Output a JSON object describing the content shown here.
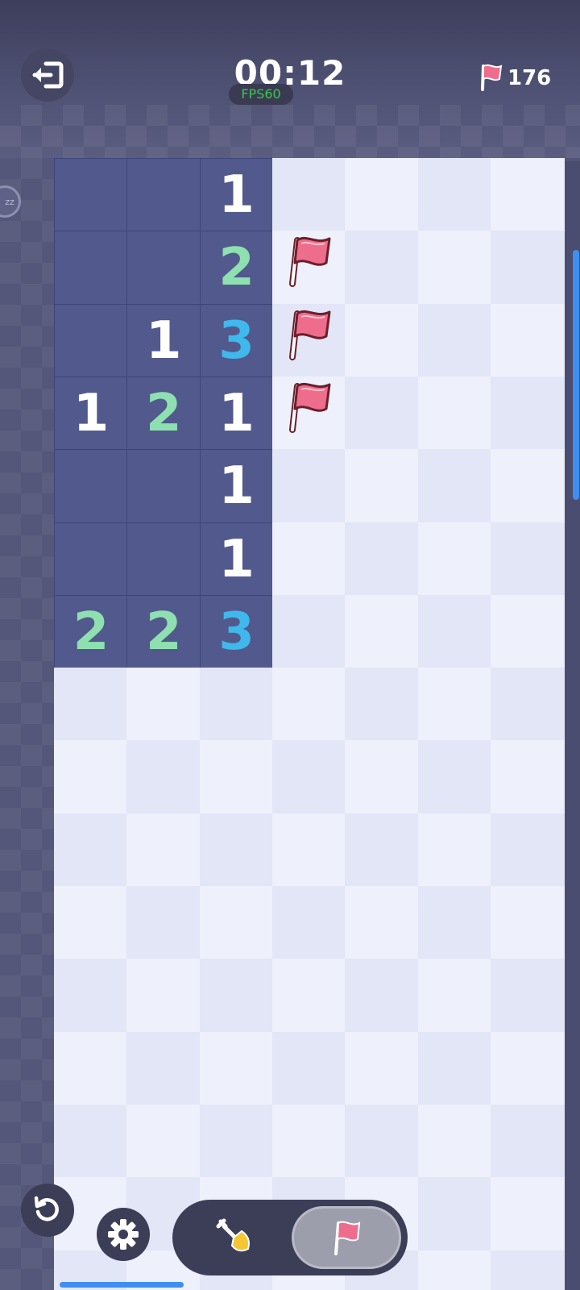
{
  "header": {
    "timer": "00:12",
    "fps": "FPS60",
    "flag_count": "176",
    "side_indicator": "zz"
  },
  "icons": {
    "exit": "exit-icon",
    "flag": "flag-icon",
    "undo": "undo-icon",
    "settings": "gear-icon",
    "dig": "shovel-icon"
  },
  "colors": {
    "revealed": "#52598c",
    "number_1": "#ffffff",
    "number_2": "#8ee0b0",
    "number_3": "#3fb8ec",
    "flag": "#ef6d8c",
    "accent": "#3f8ef0"
  },
  "board": {
    "visible_cols": 7,
    "visible_rows": 16,
    "rows": [
      [
        "R",
        "R",
        "1",
        "",
        "",
        "",
        ""
      ],
      [
        "R",
        "R",
        "2",
        "F",
        "",
        "",
        ""
      ],
      [
        "R",
        "1",
        "3",
        "F",
        "",
        "",
        ""
      ],
      [
        "1",
        "2",
        "1",
        "F",
        "",
        "",
        ""
      ],
      [
        "R",
        "R",
        "1",
        "",
        "",
        "",
        ""
      ],
      [
        "R",
        "R",
        "1",
        "",
        "",
        "",
        ""
      ],
      [
        "2",
        "2",
        "3",
        "",
        "",
        "",
        ""
      ],
      [
        "",
        "",
        "",
        "",
        "",
        "",
        ""
      ],
      [
        "",
        "",
        "",
        "",
        "",
        "",
        ""
      ],
      [
        "",
        "",
        "",
        "",
        "",
        "",
        ""
      ],
      [
        "",
        "",
        "",
        "",
        "",
        "",
        ""
      ],
      [
        "",
        "",
        "",
        "",
        "",
        "",
        ""
      ],
      [
        "",
        "",
        "",
        "",
        "",
        "",
        ""
      ],
      [
        "",
        "",
        "",
        "",
        "",
        "",
        ""
      ],
      [
        "",
        "",
        "",
        "",
        "",
        "",
        ""
      ],
      [
        "",
        "",
        "",
        "",
        "",
        "",
        ""
      ]
    ]
  },
  "toolbar": {
    "active_mode": "flag"
  }
}
